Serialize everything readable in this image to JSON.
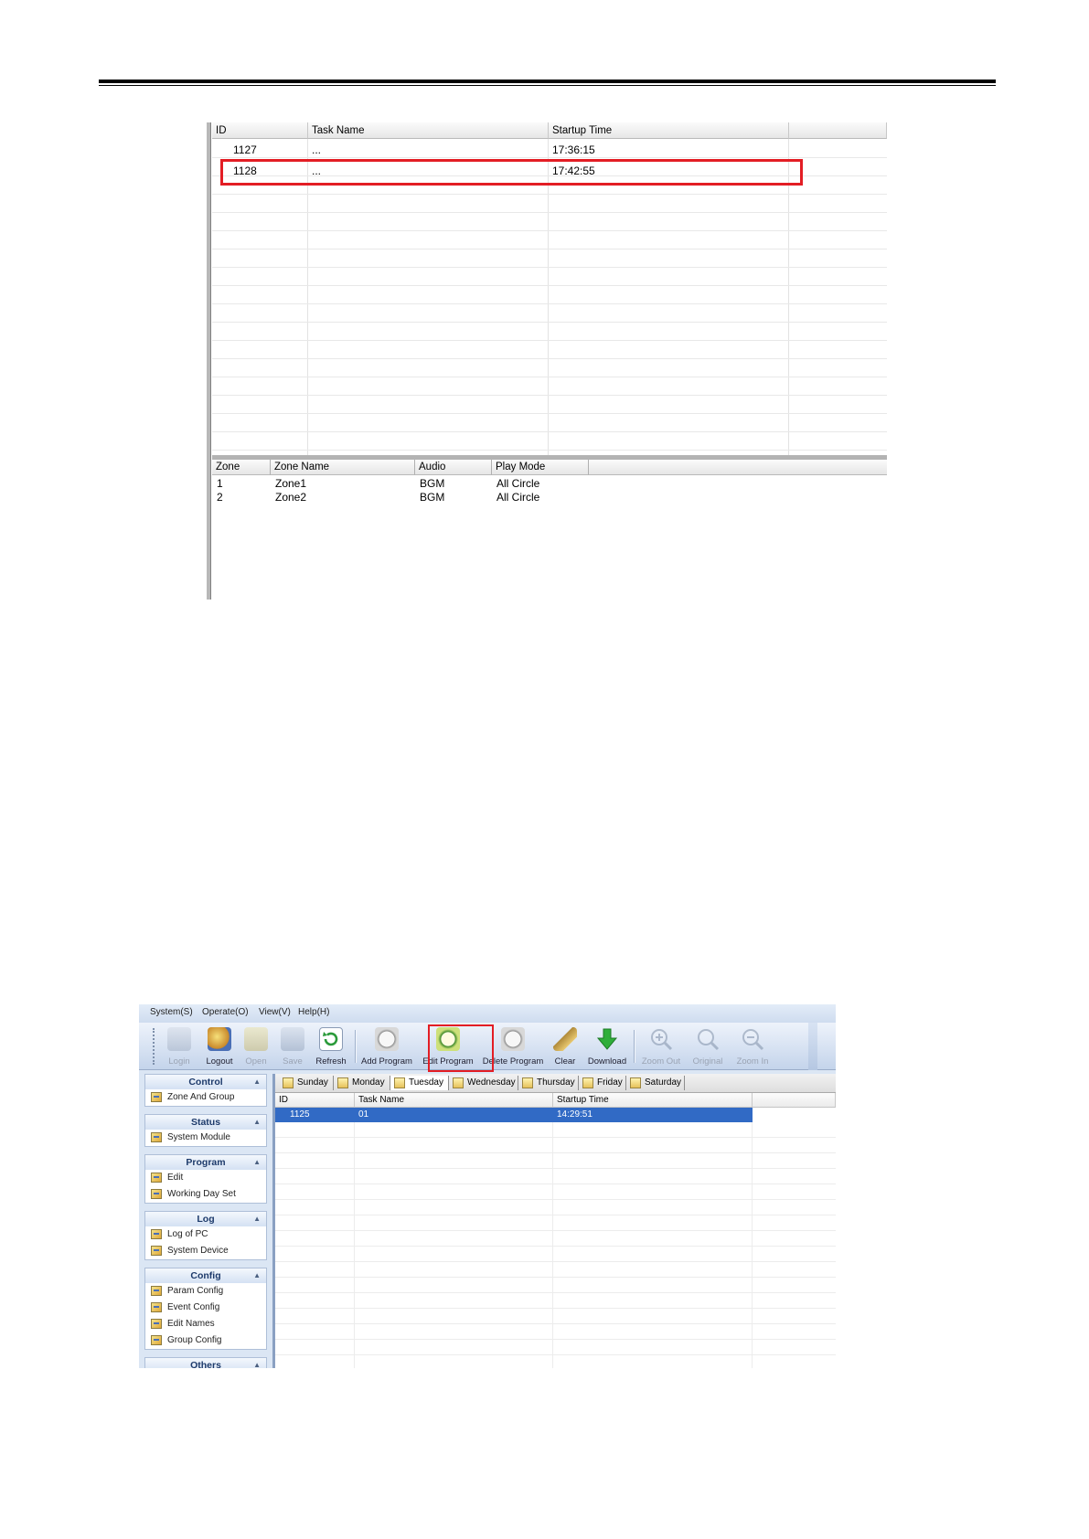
{
  "top_grid": {
    "headers": [
      "ID",
      "Task Name",
      "Startup Time"
    ],
    "rows": [
      {
        "id": "1127",
        "task_name": "...",
        "startup_time": "17:36:15"
      },
      {
        "id": "1128",
        "task_name": "...",
        "startup_time": "17:42:55"
      }
    ]
  },
  "zone_grid": {
    "headers": [
      "Zone",
      "Zone Name",
      "Audio",
      "Play Mode"
    ],
    "rows": [
      {
        "zone": "1",
        "zone_name": "Zone1",
        "audio": "BGM",
        "play_mode": "All Circle"
      },
      {
        "zone": "2",
        "zone_name": "Zone2",
        "audio": "BGM",
        "play_mode": "All Circle"
      }
    ]
  },
  "app": {
    "menu": [
      "System(S)",
      "Operate(O)",
      "View(V)",
      "Help(H)"
    ],
    "toolbar": {
      "login": "Login",
      "logout": "Logout",
      "open": "Open",
      "save": "Save",
      "refresh": "Refresh",
      "add_program": "Add Program",
      "edit_program": "Edit Program",
      "delete_program": "Delete Program",
      "clear": "Clear",
      "download": "Download",
      "zoom_out": "Zoom Out",
      "original": "Original",
      "zoom_in": "Zoom In"
    },
    "sidebar": {
      "control": {
        "title": "Control",
        "items": [
          "Zone And Group"
        ]
      },
      "status": {
        "title": "Status",
        "items": [
          "System Module"
        ]
      },
      "program": {
        "title": "Program",
        "items": [
          "Edit",
          "Working Day Set"
        ]
      },
      "log": {
        "title": "Log",
        "items": [
          "Log of PC",
          "System Device"
        ]
      },
      "config": {
        "title": "Config",
        "items": [
          "Param Config",
          "Event Config",
          "Edit Names",
          "Group Config"
        ]
      },
      "others": {
        "title": "Others"
      }
    },
    "days": [
      "Sunday",
      "Monday",
      "Tuesday",
      "Wednesday",
      "Thursday",
      "Friday",
      "Saturday"
    ],
    "grid": {
      "headers": [
        "ID",
        "Task Name",
        "Startup Time"
      ],
      "rows": [
        {
          "id": "1125",
          "task_name": "01",
          "startup_time": "14:29:51"
        }
      ]
    }
  },
  "colors": {
    "highlight_border": "#e31d24",
    "selection": "#316ac5"
  }
}
